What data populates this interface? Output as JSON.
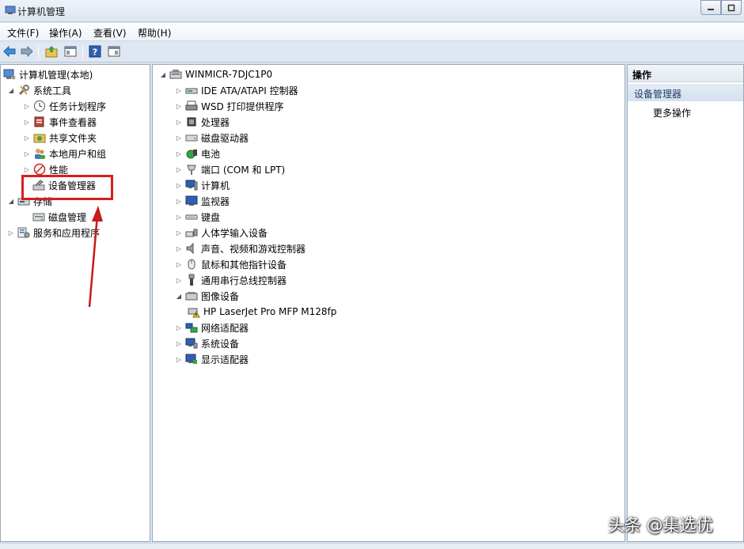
{
  "window": {
    "title": "计算机管理"
  },
  "menu": {
    "file": "文件(F)",
    "action": "操作(A)",
    "view": "查看(V)",
    "help": "帮助(H)"
  },
  "left_tree": {
    "root": "计算机管理(本地)",
    "system_tools": "系统工具",
    "task_scheduler": "任务计划程序",
    "event_viewer": "事件查看器",
    "shared_folders": "共享文件夹",
    "local_users": "本地用户和组",
    "performance": "性能",
    "device_manager": "设备管理器",
    "storage": "存储",
    "disk_management": "磁盘管理",
    "services_apps": "服务和应用程序"
  },
  "device_tree": {
    "root": "WINMICR-7DJC1P0",
    "items": [
      {
        "label": "IDE ATA/ATAPI 控制器",
        "icon": "ide-controller-icon"
      },
      {
        "label": "WSD 打印提供程序",
        "icon": "printer-icon"
      },
      {
        "label": "处理器",
        "icon": "processor-icon"
      },
      {
        "label": "磁盘驱动器",
        "icon": "disk-drive-icon"
      },
      {
        "label": "电池",
        "icon": "battery-icon"
      },
      {
        "label": "端口 (COM 和 LPT)",
        "icon": "port-icon"
      },
      {
        "label": "计算机",
        "icon": "computer-icon"
      },
      {
        "label": "监视器",
        "icon": "monitor-icon"
      },
      {
        "label": "键盘",
        "icon": "keyboard-icon"
      },
      {
        "label": "人体学输入设备",
        "icon": "hid-icon"
      },
      {
        "label": "声音、视频和游戏控制器",
        "icon": "speaker-icon"
      },
      {
        "label": "鼠标和其他指针设备",
        "icon": "mouse-icon"
      },
      {
        "label": "通用串行总线控制器",
        "icon": "usb-icon"
      },
      {
        "label": "图像设备",
        "icon": "imaging-device-icon"
      },
      {
        "label": "HP LaserJet Pro MFP M128fp",
        "icon": "scanner-warning-icon"
      },
      {
        "label": "网络适配器",
        "icon": "network-adapter-icon"
      },
      {
        "label": "系统设备",
        "icon": "system-device-icon"
      },
      {
        "label": "显示适配器",
        "icon": "display-adapter-icon"
      }
    ]
  },
  "actions_pane": {
    "header": "操作",
    "section": "设备管理器",
    "more": "更多操作"
  },
  "watermark": "头条 @集选优",
  "colors": {
    "highlight": "#d71e1e",
    "arrow": "#c81a1a",
    "section_bg": "#dce6f2"
  }
}
